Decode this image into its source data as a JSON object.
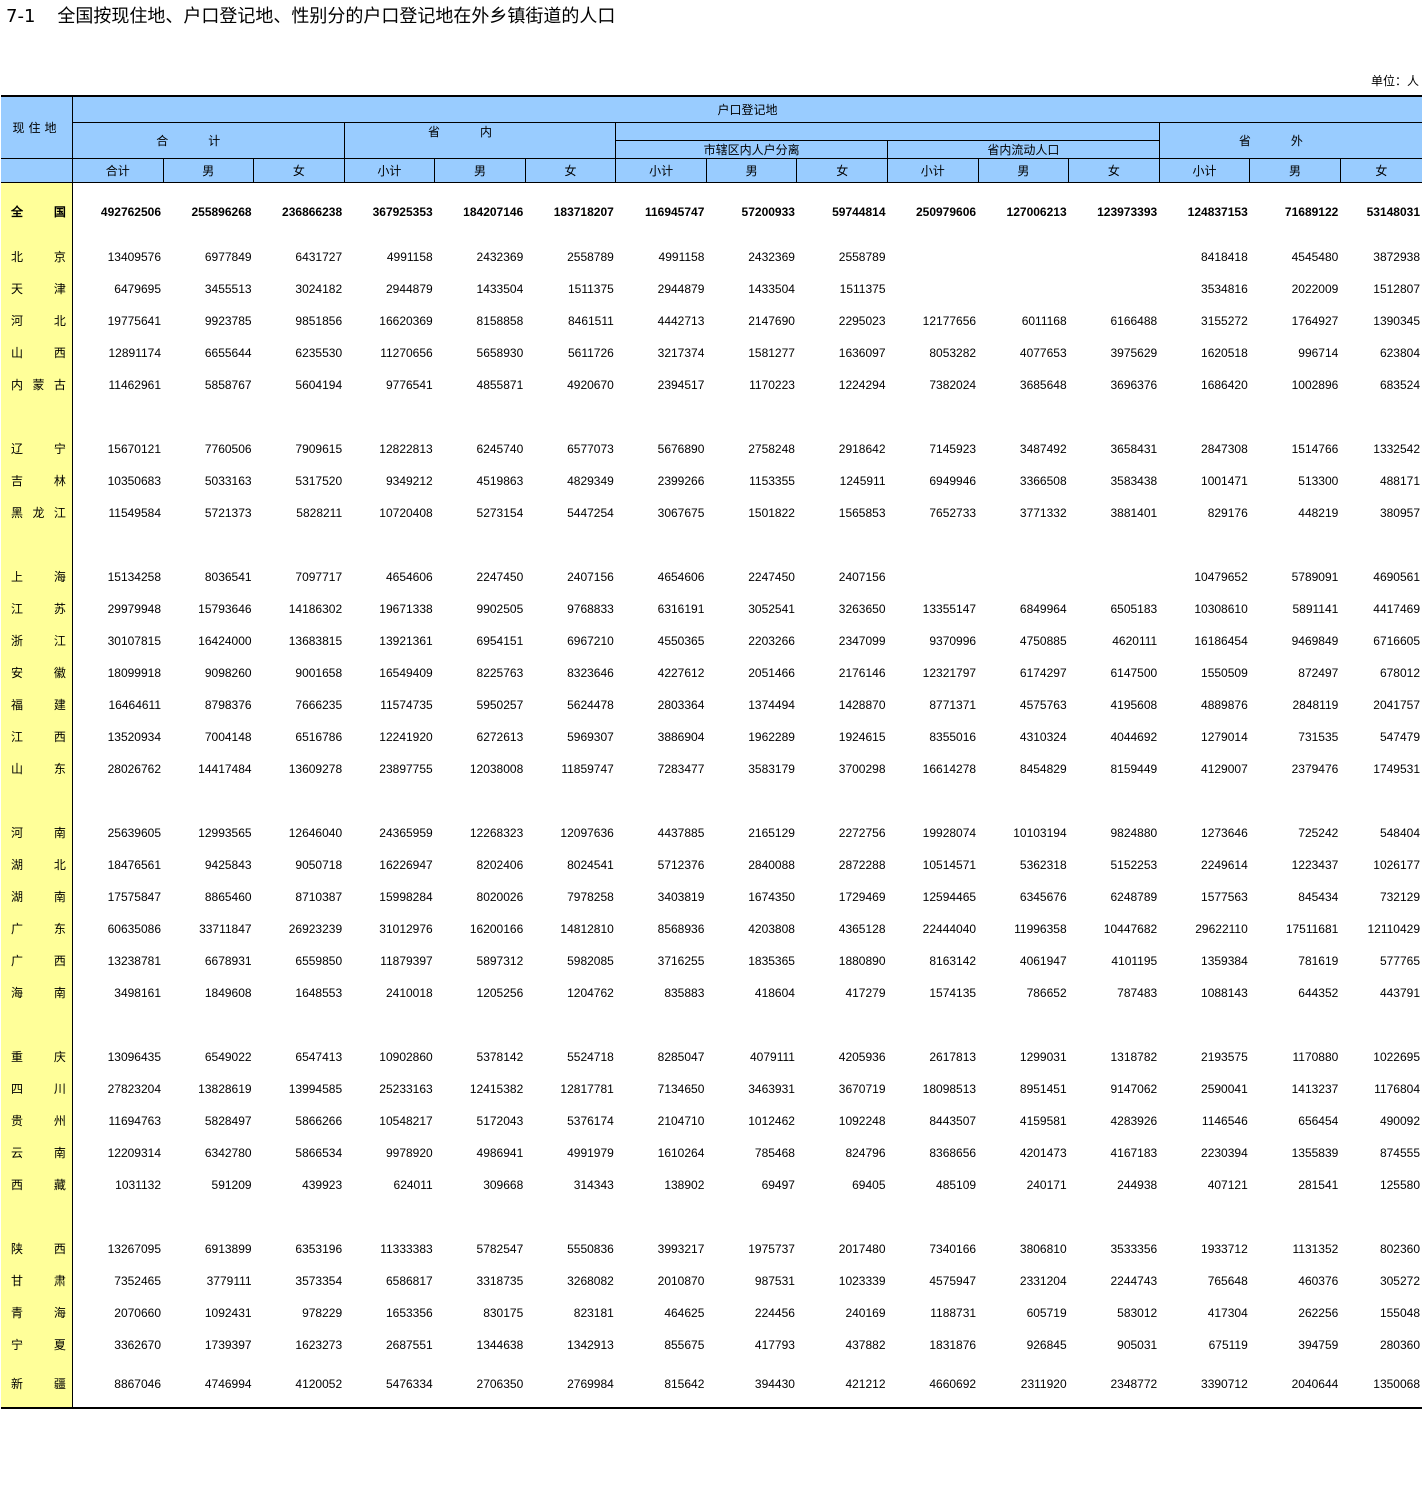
{
  "title": {
    "number": "7-1",
    "text": "全国按现住地、户口登记地、性别分的户口登记地在外乡镇街道的人口"
  },
  "unit": "单位：人",
  "header": {
    "residence": "现住地",
    "registration": "户口登记地",
    "total_group": "合计",
    "in_province": "省内",
    "city_separation": "市辖区内人户分离",
    "intra_provincial": "省内流动人口",
    "out_province": "省外",
    "sub": [
      "合计",
      "男",
      "女",
      "小计",
      "男",
      "女",
      "小计",
      "男",
      "女",
      "小计",
      "男",
      "女",
      "小计",
      "男",
      "女"
    ]
  },
  "rows": [
    {
      "name": "全国",
      "values": [
        "492762506",
        "255896268",
        "236866238",
        "367925353",
        "184207146",
        "183718207",
        "116945747",
        "57200933",
        "59744814",
        "250979606",
        "127006213",
        "123973393",
        "124837153",
        "71689122",
        "53148031"
      ]
    },
    {
      "name": "北京",
      "values": [
        "13409576",
        "6977849",
        "6431727",
        "4991158",
        "2432369",
        "2558789",
        "4991158",
        "2432369",
        "2558789",
        "",
        "",
        "",
        "8418418",
        "4545480",
        "3872938"
      ]
    },
    {
      "name": "天津",
      "values": [
        "6479695",
        "3455513",
        "3024182",
        "2944879",
        "1433504",
        "1511375",
        "2944879",
        "1433504",
        "1511375",
        "",
        "",
        "",
        "3534816",
        "2022009",
        "1512807"
      ]
    },
    {
      "name": "河北",
      "values": [
        "19775641",
        "9923785",
        "9851856",
        "16620369",
        "8158858",
        "8461511",
        "4442713",
        "2147690",
        "2295023",
        "12177656",
        "6011168",
        "6166488",
        "3155272",
        "1764927",
        "1390345"
      ]
    },
    {
      "name": "山西",
      "values": [
        "12891174",
        "6655644",
        "6235530",
        "11270656",
        "5658930",
        "5611726",
        "3217374",
        "1581277",
        "1636097",
        "8053282",
        "4077653",
        "3975629",
        "1620518",
        "996714",
        "623804"
      ]
    },
    {
      "name": "内蒙古",
      "values": [
        "11462961",
        "5858767",
        "5604194",
        "9776541",
        "4855871",
        "4920670",
        "2394517",
        "1170223",
        "1224294",
        "7382024",
        "3685648",
        "3696376",
        "1686420",
        "1002896",
        "683524"
      ]
    },
    {
      "gap": true
    },
    {
      "name": "辽宁",
      "values": [
        "15670121",
        "7760506",
        "7909615",
        "12822813",
        "6245740",
        "6577073",
        "5676890",
        "2758248",
        "2918642",
        "7145923",
        "3487492",
        "3658431",
        "2847308",
        "1514766",
        "1332542"
      ]
    },
    {
      "name": "吉林",
      "values": [
        "10350683",
        "5033163",
        "5317520",
        "9349212",
        "4519863",
        "4829349",
        "2399266",
        "1153355",
        "1245911",
        "6949946",
        "3366508",
        "3583438",
        "1001471",
        "513300",
        "488171"
      ]
    },
    {
      "name": "黑龙江",
      "values": [
        "11549584",
        "5721373",
        "5828211",
        "10720408",
        "5273154",
        "5447254",
        "3067675",
        "1501822",
        "1565853",
        "7652733",
        "3771332",
        "3881401",
        "829176",
        "448219",
        "380957"
      ]
    },
    {
      "gap": true
    },
    {
      "name": "上海",
      "values": [
        "15134258",
        "8036541",
        "7097717",
        "4654606",
        "2247450",
        "2407156",
        "4654606",
        "2247450",
        "2407156",
        "",
        "",
        "",
        "10479652",
        "5789091",
        "4690561"
      ]
    },
    {
      "name": "江苏",
      "values": [
        "29979948",
        "15793646",
        "14186302",
        "19671338",
        "9902505",
        "9768833",
        "6316191",
        "3052541",
        "3263650",
        "13355147",
        "6849964",
        "6505183",
        "10308610",
        "5891141",
        "4417469"
      ]
    },
    {
      "name": "浙江",
      "values": [
        "30107815",
        "16424000",
        "13683815",
        "13921361",
        "6954151",
        "6967210",
        "4550365",
        "2203266",
        "2347099",
        "9370996",
        "4750885",
        "4620111",
        "16186454",
        "9469849",
        "6716605"
      ]
    },
    {
      "name": "安徽",
      "values": [
        "18099918",
        "9098260",
        "9001658",
        "16549409",
        "8225763",
        "8323646",
        "4227612",
        "2051466",
        "2176146",
        "12321797",
        "6174297",
        "6147500",
        "1550509",
        "872497",
        "678012"
      ]
    },
    {
      "name": "福建",
      "values": [
        "16464611",
        "8798376",
        "7666235",
        "11574735",
        "5950257",
        "5624478",
        "2803364",
        "1374494",
        "1428870",
        "8771371",
        "4575763",
        "4195608",
        "4889876",
        "2848119",
        "2041757"
      ]
    },
    {
      "name": "江西",
      "values": [
        "13520934",
        "7004148",
        "6516786",
        "12241920",
        "6272613",
        "5969307",
        "3886904",
        "1962289",
        "1924615",
        "8355016",
        "4310324",
        "4044692",
        "1279014",
        "731535",
        "547479"
      ]
    },
    {
      "name": "山东",
      "values": [
        "28026762",
        "14417484",
        "13609278",
        "23897755",
        "12038008",
        "11859747",
        "7283477",
        "3583179",
        "3700298",
        "16614278",
        "8454829",
        "8159449",
        "4129007",
        "2379476",
        "1749531"
      ]
    },
    {
      "gap": true
    },
    {
      "name": "河南",
      "values": [
        "25639605",
        "12993565",
        "12646040",
        "24365959",
        "12268323",
        "12097636",
        "4437885",
        "2165129",
        "2272756",
        "19928074",
        "10103194",
        "9824880",
        "1273646",
        "725242",
        "548404"
      ]
    },
    {
      "name": "湖北",
      "values": [
        "18476561",
        "9425843",
        "9050718",
        "16226947",
        "8202406",
        "8024541",
        "5712376",
        "2840088",
        "2872288",
        "10514571",
        "5362318",
        "5152253",
        "2249614",
        "1223437",
        "1026177"
      ]
    },
    {
      "name": "湖南",
      "values": [
        "17575847",
        "8865460",
        "8710387",
        "15998284",
        "8020026",
        "7978258",
        "3403819",
        "1674350",
        "1729469",
        "12594465",
        "6345676",
        "6248789",
        "1577563",
        "845434",
        "732129"
      ]
    },
    {
      "name": "广东",
      "values": [
        "60635086",
        "33711847",
        "26923239",
        "31012976",
        "16200166",
        "14812810",
        "8568936",
        "4203808",
        "4365128",
        "22444040",
        "11996358",
        "10447682",
        "29622110",
        "17511681",
        "12110429"
      ]
    },
    {
      "name": "广西",
      "values": [
        "13238781",
        "6678931",
        "6559850",
        "11879397",
        "5897312",
        "5982085",
        "3716255",
        "1835365",
        "1880890",
        "8163142",
        "4061947",
        "4101195",
        "1359384",
        "781619",
        "577765"
      ]
    },
    {
      "name": "海南",
      "values": [
        "3498161",
        "1849608",
        "1648553",
        "2410018",
        "1205256",
        "1204762",
        "835883",
        "418604",
        "417279",
        "1574135",
        "786652",
        "787483",
        "1088143",
        "644352",
        "443791"
      ]
    },
    {
      "gap": true
    },
    {
      "name": "重庆",
      "values": [
        "13096435",
        "6549022",
        "6547413",
        "10902860",
        "5378142",
        "5524718",
        "8285047",
        "4079111",
        "4205936",
        "2617813",
        "1299031",
        "1318782",
        "2193575",
        "1170880",
        "1022695"
      ]
    },
    {
      "name": "四川",
      "values": [
        "27823204",
        "13828619",
        "13994585",
        "25233163",
        "12415382",
        "12817781",
        "7134650",
        "3463931",
        "3670719",
        "18098513",
        "8951451",
        "9147062",
        "2590041",
        "1413237",
        "1176804"
      ]
    },
    {
      "name": "贵州",
      "values": [
        "11694763",
        "5828497",
        "5866266",
        "10548217",
        "5172043",
        "5376174",
        "2104710",
        "1012462",
        "1092248",
        "8443507",
        "4159581",
        "4283926",
        "1146546",
        "656454",
        "490092"
      ]
    },
    {
      "name": "云南",
      "values": [
        "12209314",
        "6342780",
        "5866534",
        "9978920",
        "4986941",
        "4991979",
        "1610264",
        "785468",
        "824796",
        "8368656",
        "4201473",
        "4167183",
        "2230394",
        "1355839",
        "874555"
      ]
    },
    {
      "name": "西藏",
      "values": [
        "1031132",
        "591209",
        "439923",
        "624011",
        "309668",
        "314343",
        "138902",
        "69497",
        "69405",
        "485109",
        "240171",
        "244938",
        "407121",
        "281541",
        "125580"
      ]
    },
    {
      "gap": true
    },
    {
      "name": "陕西",
      "values": [
        "13267095",
        "6913899",
        "6353196",
        "11333383",
        "5782547",
        "5550836",
        "3993217",
        "1975737",
        "2017480",
        "7340166",
        "3806810",
        "3533356",
        "1933712",
        "1131352",
        "802360"
      ]
    },
    {
      "name": "甘肃",
      "values": [
        "7352465",
        "3779111",
        "3573354",
        "6586817",
        "3318735",
        "3268082",
        "2010870",
        "987531",
        "1023339",
        "4575947",
        "2331204",
        "2244743",
        "765648",
        "460376",
        "305272"
      ]
    },
    {
      "name": "青海",
      "values": [
        "2070660",
        "1092431",
        "978229",
        "1653356",
        "830175",
        "823181",
        "464625",
        "224456",
        "240169",
        "1188731",
        "605719",
        "583012",
        "417304",
        "262256",
        "155048"
      ]
    },
    {
      "name": "宁夏",
      "values": [
        "3362670",
        "1739397",
        "1623273",
        "2687551",
        "1344638",
        "1342913",
        "855675",
        "417793",
        "437882",
        "1831876",
        "926845",
        "905031",
        "675119",
        "394759",
        "280360"
      ]
    },
    {
      "name": "新疆",
      "values": [
        "8867046",
        "4746994",
        "4120052",
        "5476334",
        "2706350",
        "2769984",
        "815642",
        "394430",
        "421212",
        "4660692",
        "2311920",
        "2348772",
        "3390712",
        "2040644",
        "1350068"
      ]
    }
  ],
  "colors": {
    "header_bg": "#99ccff",
    "name_bg": "#ffff99"
  }
}
